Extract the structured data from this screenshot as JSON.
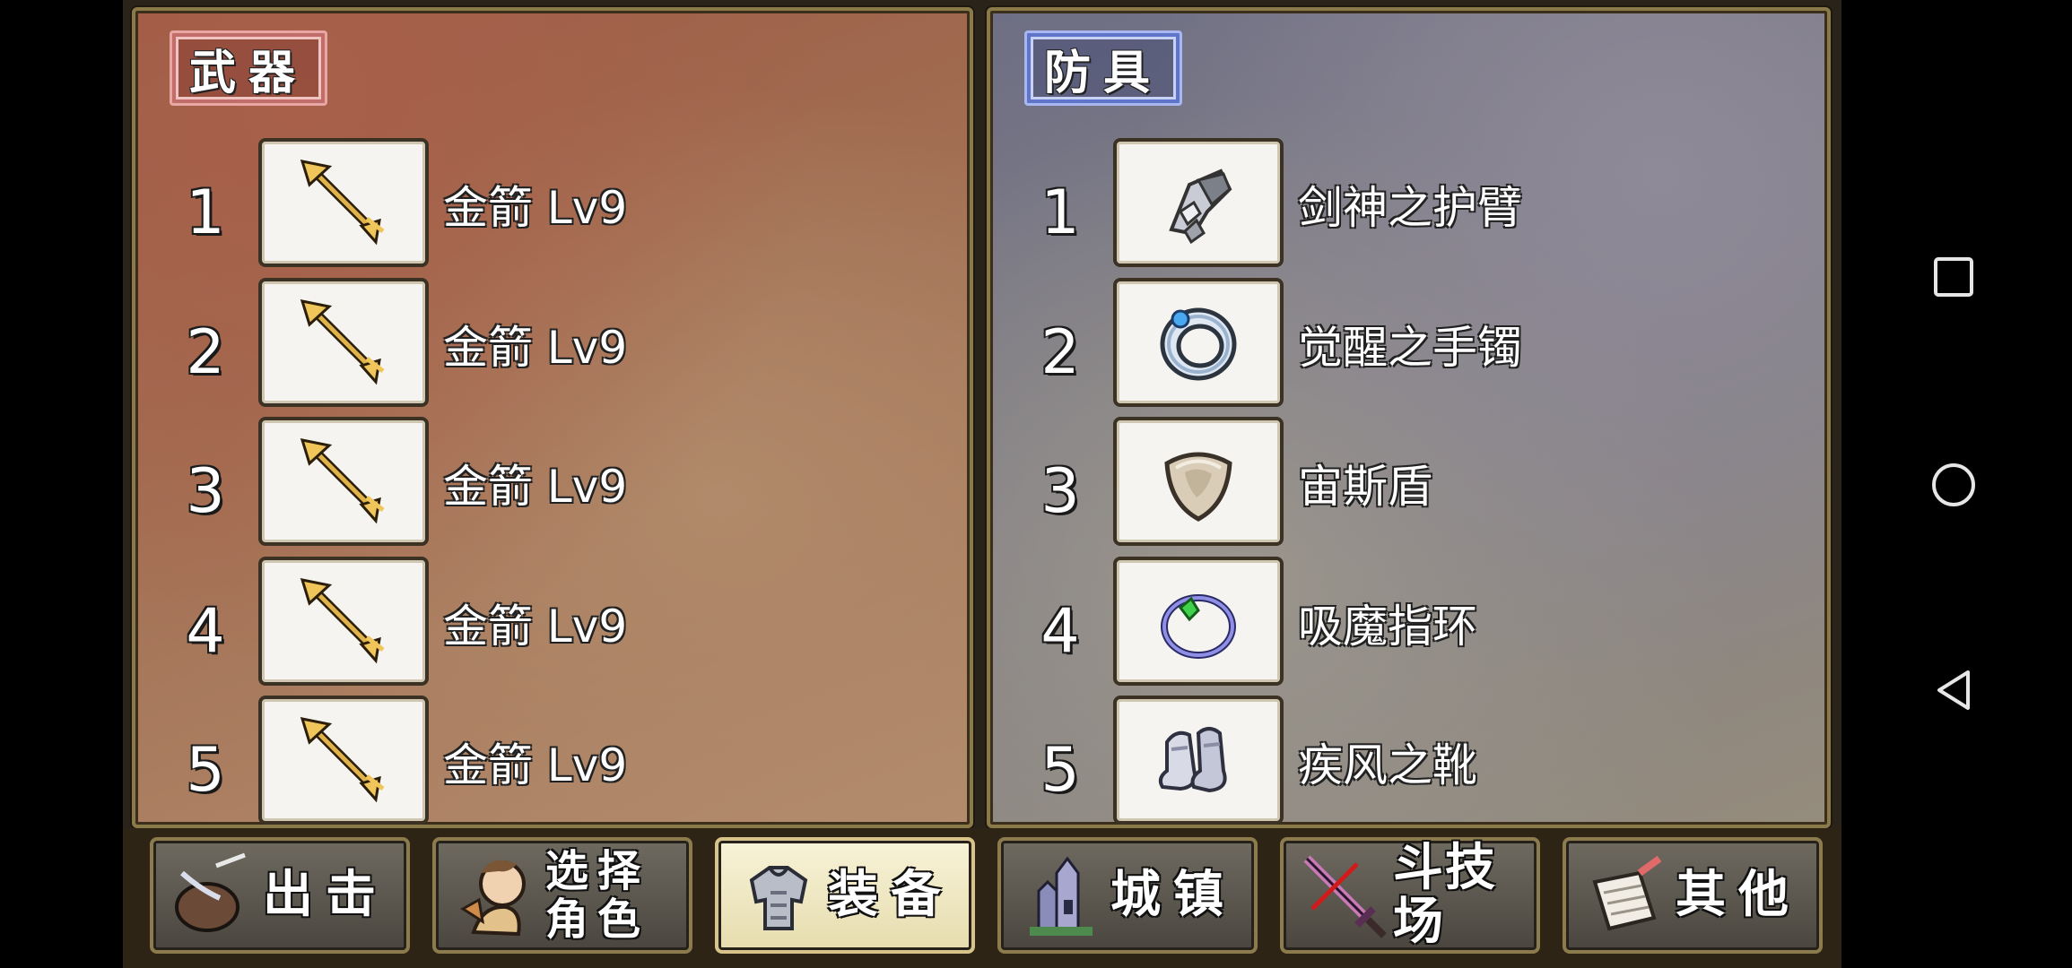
{
  "weapons": {
    "title": "武器",
    "items": [
      {
        "num": "1",
        "name": "金箭 Lv9",
        "icon": "golden-arrow-icon"
      },
      {
        "num": "2",
        "name": "金箭 Lv9",
        "icon": "golden-arrow-icon"
      },
      {
        "num": "3",
        "name": "金箭 Lv9",
        "icon": "golden-arrow-icon"
      },
      {
        "num": "4",
        "name": "金箭 Lv9",
        "icon": "golden-arrow-icon"
      },
      {
        "num": "5",
        "name": "金箭 Lv9",
        "icon": "golden-arrow-icon"
      }
    ]
  },
  "armor": {
    "title": "防具",
    "items": [
      {
        "num": "1",
        "name": "剑神之护臂",
        "icon": "gauntlet-icon"
      },
      {
        "num": "2",
        "name": "觉醒之手镯",
        "icon": "bracelet-icon"
      },
      {
        "num": "3",
        "name": "宙斯盾",
        "icon": "shield-icon"
      },
      {
        "num": "4",
        "name": "吸魔指环",
        "icon": "ring-icon"
      },
      {
        "num": "5",
        "name": "疾风之靴",
        "icon": "boots-icon"
      }
    ]
  },
  "nav": {
    "sortie": "出击",
    "select_line1": "选择",
    "select_line2": "角色",
    "equip": "装备",
    "town": "城镇",
    "arena": "斗技场",
    "other": "其他",
    "active": "equip"
  },
  "system_nav": [
    "recent-apps-icon",
    "home-icon",
    "back-icon"
  ]
}
